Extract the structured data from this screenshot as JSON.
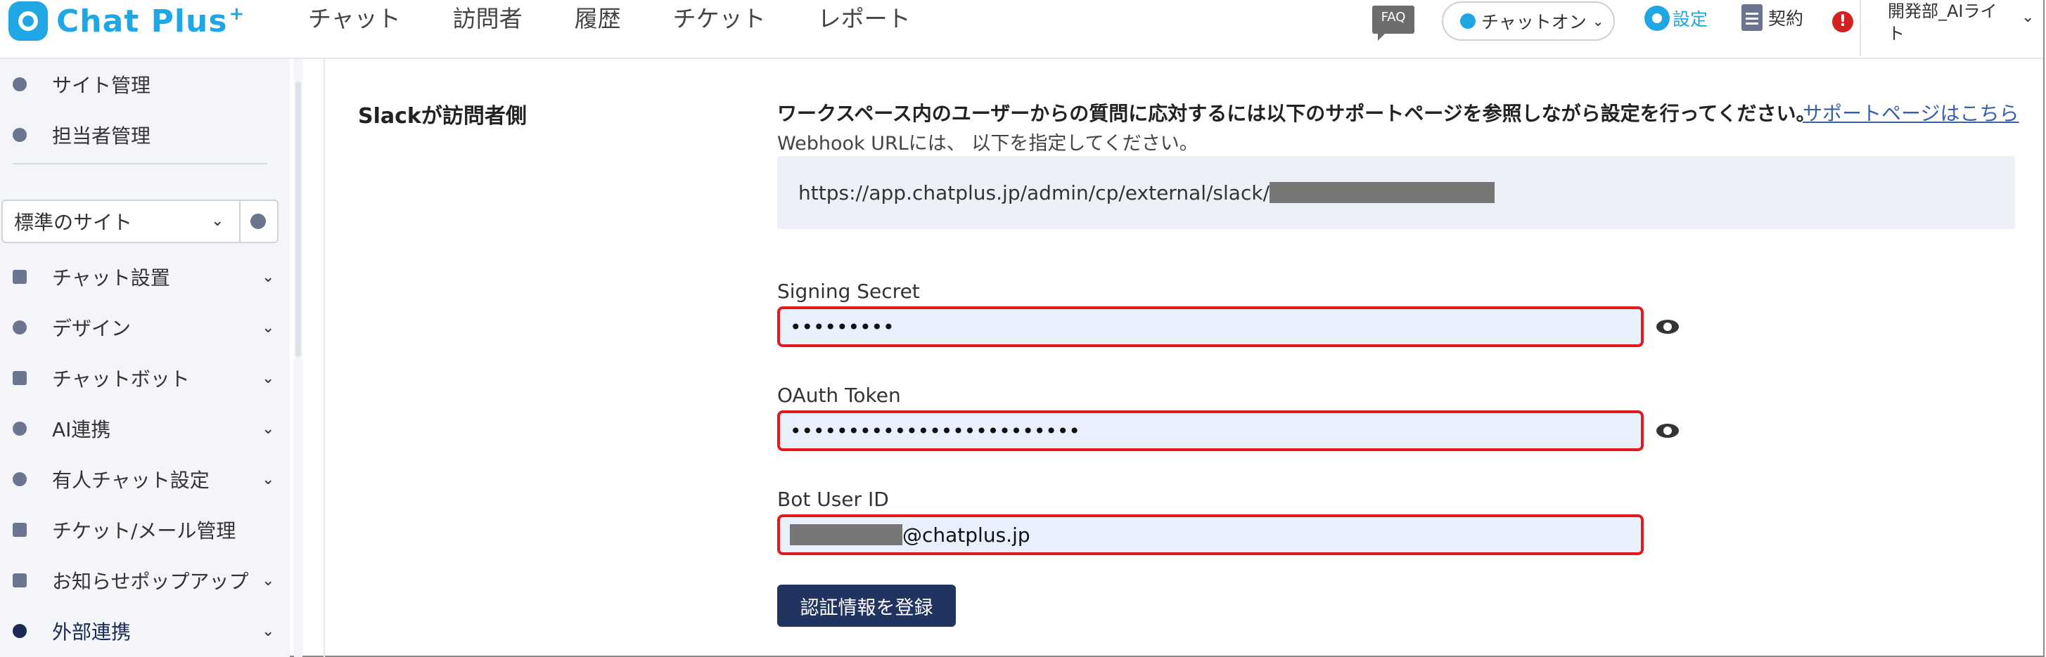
{
  "header": {
    "logo_text": "Chat Plus",
    "logo_sup": "+",
    "nav": [
      "チャット",
      "訪問者",
      "履歴",
      "チケット",
      "レポート"
    ],
    "faq": "FAQ",
    "chat_status": "チャットオン",
    "settings": "設定",
    "contract": "契約",
    "alert": "!",
    "user_line1": "開発部_AIライ",
    "user_line2": "ト"
  },
  "sidebar": {
    "top_items": [
      {
        "label": "サイト管理",
        "icon": "site-gear-icon"
      },
      {
        "label": "担当者管理",
        "icon": "people-icon"
      }
    ],
    "site_select": "標準のサイト",
    "menu": [
      {
        "label": "チャット設置",
        "icon": "tools-icon"
      },
      {
        "label": "デザイン",
        "icon": "palette-icon"
      },
      {
        "label": "チャットボット",
        "icon": "chat-bubbles-icon"
      },
      {
        "label": "AI連携",
        "icon": "bulb-icon"
      },
      {
        "label": "有人チャット設定",
        "icon": "headset-icon"
      },
      {
        "label": "チケット/メール管理",
        "icon": "list-icon"
      },
      {
        "label": "お知らせポップアップ",
        "icon": "popup-icon"
      },
      {
        "label": "外部連携",
        "icon": "share-icon"
      }
    ]
  },
  "main": {
    "section_title": "Slackが訪問者側",
    "description": "ワークスペース内のユーザーからの質問に応対するには以下のサポートページを参照しながら設定を行ってください。",
    "support_link": "サポートページはこちら",
    "webhook_note": "Webhook URLには、 以下を指定してください。",
    "webhook_url": "https://app.chatplus.jp/admin/cp/external/slack/",
    "signing_label": "Signing Secret",
    "signing_value": "•••••••••",
    "oauth_label": "OAuth Token",
    "oauth_value": "•••••••••••••••••••••••••",
    "bot_label": "Bot User ID",
    "bot_value_suffix": "@chatplus.jp",
    "submit": "認証情報を登録"
  }
}
